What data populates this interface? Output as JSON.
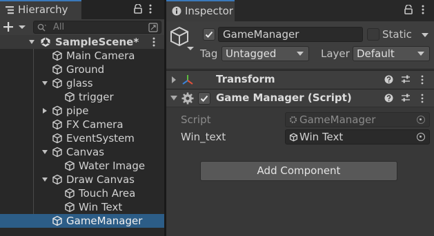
{
  "hierarchy": {
    "tab_title": "Hierarchy",
    "search_placeholder": "All",
    "scene_name": "SampleScene*",
    "items": [
      {
        "label": "Main Camera"
      },
      {
        "label": "Ground"
      },
      {
        "label": "glass"
      },
      {
        "label": "trigger"
      },
      {
        "label": "pipe"
      },
      {
        "label": "FX Camera"
      },
      {
        "label": "EventSystem"
      },
      {
        "label": "Canvas"
      },
      {
        "label": "Water Image"
      },
      {
        "label": "Draw Canvas"
      },
      {
        "label": "Touch Area"
      },
      {
        "label": "Win Text"
      },
      {
        "label": "GameManager"
      }
    ]
  },
  "inspector": {
    "tab_title": "Inspector",
    "object_name": "GameManager",
    "static_label": "Static",
    "tag_label": "Tag",
    "tag_value": "Untagged",
    "layer_label": "Layer",
    "layer_value": "Default",
    "components": {
      "transform": {
        "title": "Transform"
      },
      "script": {
        "title": "Game Manager (Script)",
        "script_label": "Script",
        "script_value": "GameManager",
        "win_text_label": "Win_text",
        "win_text_value": "Win Text"
      }
    },
    "add_component_label": "Add Component"
  },
  "colors": {
    "selection": "#2c5d87",
    "tab_accent": "#3a79bb",
    "panel_bg": "#282828",
    "inspector_bg": "#383838"
  },
  "icons": [
    "hierarchy-icon",
    "lock-icon",
    "more-icon",
    "plus-icon",
    "search-icon",
    "unity-scene-icon",
    "gameobject-icon",
    "info-icon",
    "help-icon",
    "settings-icon",
    "transform-icon",
    "gear-icon",
    "object-picker-icon"
  ]
}
